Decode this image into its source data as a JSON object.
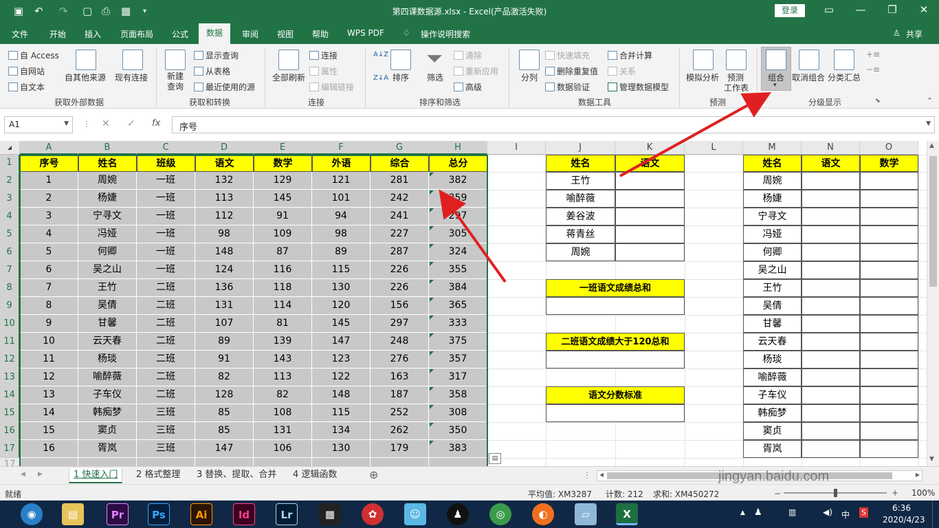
{
  "titlebar": {
    "title": "第四课数据源.xlsx  -  Excel(产品激活失败)",
    "login": "登录"
  },
  "tabs": [
    "文件",
    "开始",
    "插入",
    "页面布局",
    "公式",
    "数据",
    "审阅",
    "视图",
    "帮助",
    "WPS PDF",
    "操作说明搜索",
    "共享"
  ],
  "ribbon": {
    "get_external": {
      "access": "自 Access",
      "web": "自网站",
      "text": "自文本",
      "other": "自其他来源",
      "existing": "现有连接",
      "label": "获取外部数据"
    },
    "transform": {
      "new_query": "新建查询",
      "show_query": "显示查询",
      "from_table": "从表格",
      "recent": "最近使用的源",
      "label": "获取和转换"
    },
    "connections": {
      "refresh": "全部刷新",
      "connections": "连接",
      "properties": "属性",
      "edit_links": "编辑链接",
      "label": "连接"
    },
    "sort": {
      "sort": "排序",
      "filter": "筛选",
      "clear": "清除",
      "reapply": "重新应用",
      "advanced": "高级",
      "label": "排序和筛选"
    },
    "tools": {
      "split": "分列",
      "flash_fill": "快速填充",
      "remove_dup": "删除重复值",
      "validation": "数据验证",
      "consolidate": "合并计算",
      "relations": "关系",
      "model": "管理数据模型",
      "label": "数据工具"
    },
    "forecast": {
      "whatif": "模拟分析",
      "sheet": "预测",
      "sheet2": "工作表",
      "label": "预测"
    },
    "outline": {
      "group": "组合",
      "ungroup": "取消组合",
      "subtotal": "分类汇总",
      "label": "分级显示"
    }
  },
  "formula": {
    "namebox": "A1",
    "fx": "fx",
    "content": "序号"
  },
  "columns": [
    "A",
    "B",
    "C",
    "D",
    "E",
    "F",
    "G",
    "H",
    "I",
    "J",
    "K",
    "L",
    "M",
    "N",
    "O"
  ],
  "rows": [
    "1",
    "2",
    "3",
    "4",
    "5",
    "6",
    "7",
    "8",
    "9",
    "10",
    "11",
    "12",
    "13",
    "14",
    "15",
    "16",
    "17"
  ],
  "table": {
    "headers": [
      "序号",
      "姓名",
      "班级",
      "语文",
      "数学",
      "外语",
      "综合",
      "总分"
    ],
    "rows": [
      [
        "1",
        "周婉",
        "一班",
        "132",
        "129",
        "121",
        "281",
        "382"
      ],
      [
        "2",
        "杨婕",
        "一班",
        "113",
        "145",
        "101",
        "242",
        "359"
      ],
      [
        "3",
        "宁寻文",
        "一班",
        "112",
        "91",
        "94",
        "241",
        "297"
      ],
      [
        "4",
        "冯娅",
        "一班",
        "98",
        "109",
        "98",
        "227",
        "305"
      ],
      [
        "5",
        "何卿",
        "一班",
        "148",
        "87",
        "89",
        "287",
        "324"
      ],
      [
        "6",
        "吴之山",
        "一班",
        "124",
        "116",
        "115",
        "226",
        "355"
      ],
      [
        "7",
        "王竹",
        "二班",
        "136",
        "118",
        "130",
        "226",
        "384"
      ],
      [
        "8",
        "吴倩",
        "二班",
        "131",
        "114",
        "120",
        "156",
        "365"
      ],
      [
        "9",
        "甘馨",
        "二班",
        "107",
        "81",
        "145",
        "297",
        "333"
      ],
      [
        "10",
        "云天春",
        "二班",
        "89",
        "139",
        "147",
        "248",
        "375"
      ],
      [
        "11",
        "杨琰",
        "二班",
        "91",
        "143",
        "123",
        "276",
        "357"
      ],
      [
        "12",
        "喻醉薇",
        "二班",
        "82",
        "113",
        "122",
        "163",
        "317"
      ],
      [
        "13",
        "子车仪",
        "二班",
        "128",
        "82",
        "148",
        "187",
        "358"
      ],
      [
        "14",
        "韩痴梦",
        "三班",
        "85",
        "108",
        "115",
        "252",
        "308"
      ],
      [
        "15",
        "窦贞",
        "三班",
        "85",
        "131",
        "134",
        "262",
        "350"
      ],
      [
        "16",
        "胥岚",
        "三班",
        "147",
        "106",
        "130",
        "179",
        "383"
      ]
    ]
  },
  "lookup": {
    "h1": "姓名",
    "h2": "语文",
    "names": [
      "王竹",
      "喻醉薇",
      "姜谷波",
      "蒋青丝",
      "周婉"
    ]
  },
  "summary": {
    "s1": "一班语文成绩总和",
    "s2": "二班语文成绩大于120总和",
    "s3": "语文分数标准"
  },
  "right_table": {
    "h": [
      "姓名",
      "语文",
      "数学"
    ],
    "names": [
      "周婉",
      "杨婕",
      "宁寻文",
      "冯娅",
      "何卿",
      "吴之山",
      "王竹",
      "吴倩",
      "甘馨",
      "云天春",
      "杨琰",
      "喻醉薇",
      "子车仪",
      "韩痴梦",
      "窦贞",
      "胥岚"
    ]
  },
  "sheets": [
    "1 快速入门",
    "2 格式整理",
    "3 替换、提取、合并",
    "4 逻辑函数"
  ],
  "status": {
    "ready": "就绪",
    "avg": "平均值: XM3287",
    "count": "计数: 212",
    "sum": "求和: XM450272",
    "zoom": "100%"
  },
  "clock": {
    "time": "6:36",
    "date": "2020/4/23"
  },
  "watermark": "jingyan.baidu.com",
  "taskbar_labels": [
    "Pr",
    "Ps",
    "Ai",
    "Id",
    "Lr"
  ],
  "colors": {
    "excel_green": "#217346",
    "yellow": "#ffff00",
    "arrow": "#e02020"
  }
}
